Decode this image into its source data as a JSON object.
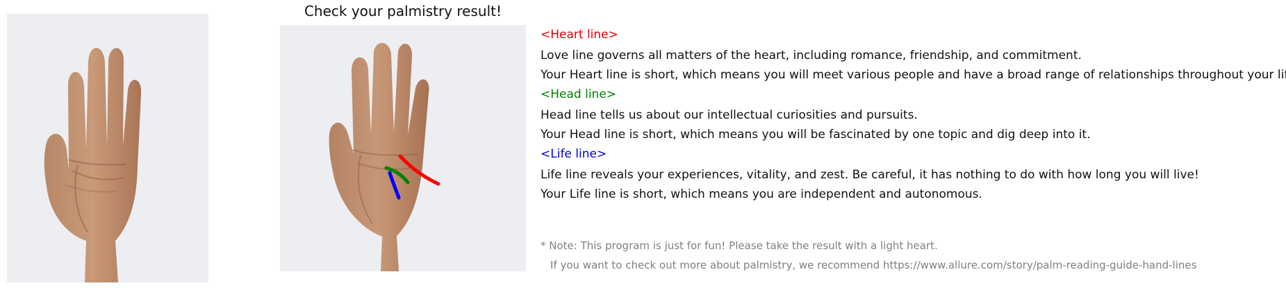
{
  "title": "Check your palmistry result!",
  "images": {
    "original": "hand-photo",
    "result": "hand-photo-with-lines"
  },
  "lines": [
    {
      "heading": "<Heart line>",
      "color": "#e00000",
      "description": "Love line governs all matters of the heart, including romance, friendship, and commitment.",
      "result": "Your Heart line is short, which means you will meet various people and have a broad range of relationships throughout your life."
    },
    {
      "heading": "<Head line>",
      "color": "#008000",
      "description": "Head line tells us about our intellectual curiosities and pursuits.",
      "result": "Your Head line is short, which means you will be fascinated by one topic and dig deep into it."
    },
    {
      "heading": "<Life line>",
      "color": "#0000d0",
      "description": "Life line reveals your experiences, vitality, and zest. Be careful, it has nothing to do with how long you will live!",
      "result": "Your Life line is short, which means you are independent and autonomous."
    }
  ],
  "note": {
    "line1": "* Note: This program is just for fun! Please take the result with a light heart.",
    "line2": "If you want to check out more about palmistry, we recommend https://www.allure.com/story/palm-reading-guide-hand-lines",
    "color": "#808080"
  }
}
